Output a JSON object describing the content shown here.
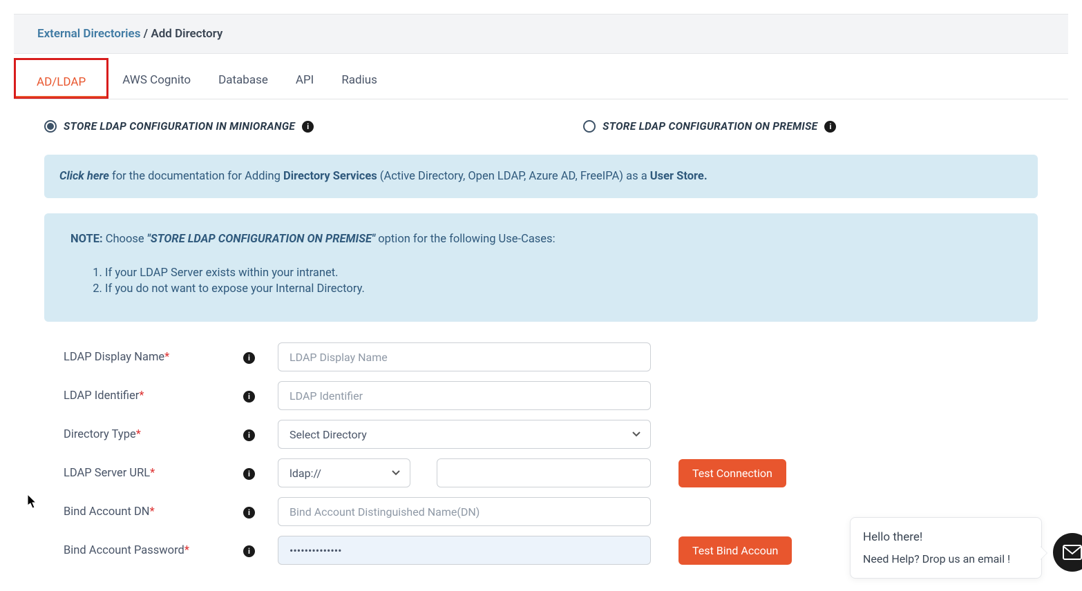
{
  "breadcrumb": {
    "link": "External Directories",
    "sep": " / ",
    "current": "Add Directory"
  },
  "tabs": [
    {
      "label": "AD/LDAP",
      "active": true
    },
    {
      "label": "AWS Cognito",
      "active": false
    },
    {
      "label": "Database",
      "active": false
    },
    {
      "label": "API",
      "active": false
    },
    {
      "label": "Radius",
      "active": false
    }
  ],
  "radios": {
    "opt1": "STORE LDAP CONFIGURATION IN MINIORANGE",
    "opt2": "STORE LDAP CONFIGURATION ON PREMISE"
  },
  "doc_alert": {
    "click": "Click here",
    "mid1": " for the documentation for Adding ",
    "bold1": "Directory Services",
    "mid2": " (Active Directory, Open LDAP, Azure AD, FreeIPA) as a ",
    "bold2": "User Store."
  },
  "note": {
    "label": "NOTE:",
    "pre": "  Choose ",
    "bold": "\"STORE LDAP CONFIGURATION ON PREMISE\"",
    "post": " option for the following Use-Cases:",
    "items": [
      "If your LDAP Server exists within your intranet.",
      "If you do not want to expose your Internal Directory."
    ]
  },
  "form": {
    "display_name": {
      "label": "LDAP Display Name",
      "placeholder": "LDAP Display Name",
      "value": ""
    },
    "identifier": {
      "label": "LDAP Identifier",
      "placeholder": "LDAP Identifier",
      "value": ""
    },
    "dir_type": {
      "label": "Directory Type",
      "selected": "Select Directory"
    },
    "server_url": {
      "label": "LDAP Server URL",
      "protocol": "ldap://",
      "host": ""
    },
    "bind_dn": {
      "label": "Bind Account DN",
      "placeholder": "Bind Account Distinguished Name(DN)",
      "value": ""
    },
    "bind_pw": {
      "label": "Bind Account Password",
      "value": "••••••••••••••"
    }
  },
  "buttons": {
    "test_conn": "Test Connection",
    "test_bind": "Test Bind Accoun"
  },
  "chat": {
    "line1": "Hello there!",
    "line2": "Need Help? Drop us an email !"
  }
}
